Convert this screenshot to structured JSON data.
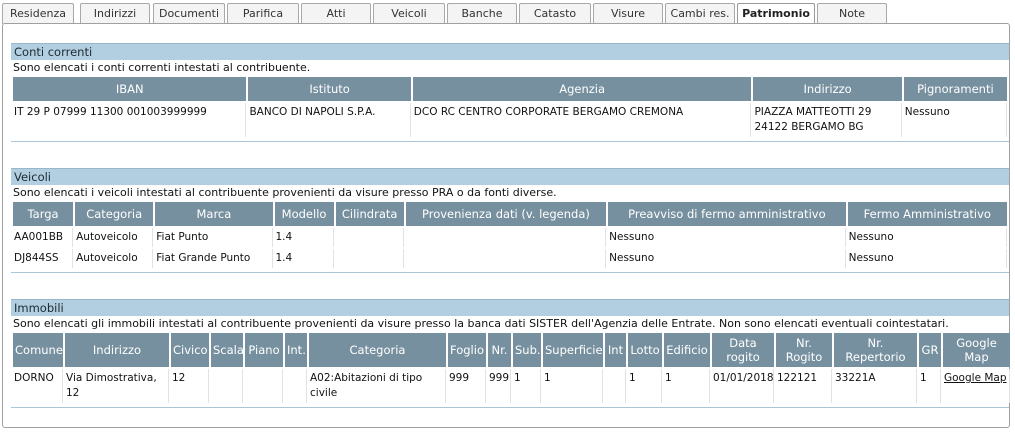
{
  "tabs": [
    {
      "label": "Residenza",
      "active": false
    },
    {
      "label": "Indirizzi",
      "active": false
    },
    {
      "label": "Documenti",
      "active": false
    },
    {
      "label": "Parifica",
      "active": false
    },
    {
      "label": "Atti",
      "active": false
    },
    {
      "label": "Veicoli",
      "active": false
    },
    {
      "label": "Banche",
      "active": false
    },
    {
      "label": "Catasto",
      "active": false
    },
    {
      "label": "Visure",
      "active": false
    },
    {
      "label": "Cambi res.",
      "active": false
    },
    {
      "label": "Patrimonio",
      "active": true
    },
    {
      "label": "Note",
      "active": false
    }
  ],
  "conti": {
    "title": "Conti correnti",
    "description": "Sono elencati i conti correnti intestati al contribuente.",
    "headers": [
      "IBAN",
      "Istituto",
      "Agenzia",
      "Indirizzo",
      "Pignoramenti"
    ],
    "rows": [
      {
        "iban": "IT 29 P 07999 11300 001003999999",
        "istituto": "BANCO DI NAPOLI S.P.A.",
        "agenzia": "DCO RC CENTRO CORPORATE BERGAMO CREMONA",
        "indirizzo_1": "PIAZZA MATTEOTTI 29",
        "indirizzo_2": "24122 BERGAMO BG",
        "pignoramenti": "Nessuno"
      }
    ]
  },
  "veicoli": {
    "title": "Veicoli",
    "description": "Sono elencati i veicoli intestati al contribuente provenienti da visure presso PRA o da fonti diverse.",
    "headers": [
      "Targa",
      "Categoria",
      "Marca",
      "Modello",
      "Cilindrata",
      "Provenienza dati (v. legenda)",
      "Preavviso di fermo amministrativo",
      "Fermo Amministrativo"
    ],
    "rows": [
      {
        "targa": "AA001BB",
        "categoria": "Autoveicolo",
        "marca": "Fiat Punto",
        "modello": "1.4",
        "cilindrata": "",
        "provenienza": "",
        "preavviso": "Nessuno",
        "fermo": "Nessuno"
      },
      {
        "targa": "DJ844SS",
        "categoria": "Autoveicolo",
        "marca": "Fiat Grande Punto",
        "modello": "1.4",
        "cilindrata": "",
        "provenienza": "",
        "preavviso": "Nessuno",
        "fermo": "Nessuno"
      }
    ]
  },
  "immobili": {
    "title": "Immobili",
    "description": "Sono elencati gli immobili intestati al contribuente provenienti da visure presso la banca dati SISTER dell'Agenzia delle Entrate. Non sono elencati eventuali cointestatari.",
    "headers": [
      "Comune",
      "Indirizzo",
      "Civico",
      "Scala",
      "Piano",
      "Int.",
      "Categoria",
      "Foglio",
      "Nr.",
      "Sub.",
      "Superficie",
      "Int",
      "Lotto",
      "Edificio",
      "Data rogito",
      "Nr. Rogito",
      "Nr. Repertorio",
      "GR",
      "Google Map"
    ],
    "rows": [
      {
        "comune": "DORNO",
        "indirizzo": "Via Dimostrativa, 12",
        "civico": "12",
        "scala": "",
        "piano": "",
        "int1": "",
        "categoria": "A02:Abitazioni di tipo civile",
        "foglio": "999",
        "nr": "999",
        "sub": "1",
        "superficie": "1",
        "int2": "",
        "lotto": "1",
        "edificio": "1",
        "data_rogito": "01/01/2018",
        "nr_rogito": "122121",
        "nr_repertorio": "33221A",
        "gr": "1",
        "map_link": "Google Map"
      }
    ]
  }
}
